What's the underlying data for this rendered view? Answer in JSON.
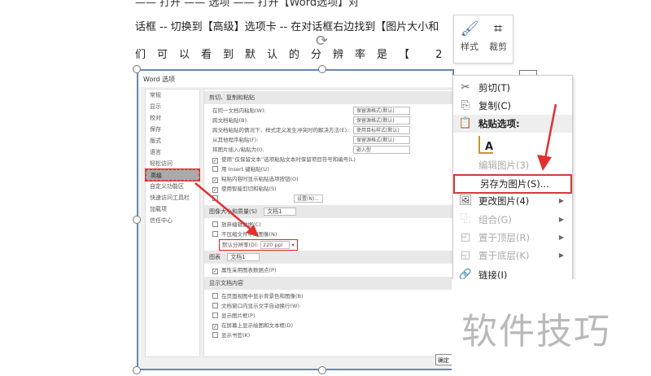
{
  "doc": {
    "line1": "—— 打开 —— 选项 —— 打开【Word选项】对",
    "line2": "话框 -- 切换到【高级】选项卡 -- 在对话框右边找到【图片大小和",
    "line3": "们可以看到默认的分辨率是【 220"
  },
  "mini_toolbar": {
    "style": "样式",
    "crop": "裁剪"
  },
  "dialog": {
    "title": "Word 选项",
    "nav": [
      "常规",
      "显示",
      "校对",
      "保存",
      "版式",
      "语言",
      "轻松访问",
      "高级",
      "自定义功能区",
      "快速访问工具栏",
      "加载项",
      "信任中心"
    ],
    "sec_cut": "剪切、复制和粘贴",
    "paste_rows": [
      {
        "label": "在同一文档内粘贴(W):",
        "value": "保留源格式(默认)"
      },
      {
        "label": "跨文档粘贴(B):",
        "value": "保留源格式(默认)"
      },
      {
        "label": "跨文档粘贴的情况下，样式定义发生冲突时的解决方法(E):",
        "value": "使用目标样式(默认)"
      },
      {
        "label": "从其他程序粘贴(F):",
        "value": "保留源格式(默认)"
      },
      {
        "label": "将图片插入/粘贴为(I):",
        "value": "嵌入型"
      }
    ],
    "paste_checks": [
      {
        "label": "使用“仅保留文本”选项粘贴文本时保留项目符号和编号(L)",
        "checked": true
      },
      {
        "label": "用 Insert 键粘贴(U)",
        "checked": false
      },
      {
        "label": "粘贴内容时显示粘贴选项按钮(O)",
        "checked": true
      },
      {
        "label": "使用智能剪切和粘贴(S)",
        "checked": true
      }
    ],
    "settings_btn": "设置(N)...",
    "sec_image": "图像大小和质量(S)",
    "doc_name": "文档1",
    "image_checks": [
      {
        "label": "放弃编辑数据(C)",
        "checked": false
      },
      {
        "label": "不压缩文件中的图像(N)",
        "checked": false
      }
    ],
    "resolution_label": "默认分辨率(D):",
    "resolution_value": "220 ppi",
    "sec_chart": "图表",
    "chart_check": "属性采用图表数据点(P)",
    "sec_display": "显示文档内容",
    "display_checks": [
      {
        "label": "在页面视图中显示背景色和图像(B)",
        "checked": false
      },
      {
        "label": "文档窗口内显示文字自动换行(W)",
        "checked": false
      },
      {
        "label": "显示图片框(P)",
        "checked": false
      },
      {
        "label": "在屏幕上显示绘图和文本框(D)",
        "checked": true
      },
      {
        "label": "显示书签(K)",
        "checked": false
      }
    ],
    "ok": "确定"
  },
  "context_menu": {
    "cut": "剪切(T)",
    "copy": "复制(C)",
    "paste_options": "粘贴选项:",
    "edit_picture": "编辑图片(3)",
    "save_as_picture": "另存为图片(S)...",
    "change_picture": "更改图片(4)",
    "group": "组合(G)",
    "bring_front": "置于顶层(R)",
    "send_back": "置于底层(K)",
    "link": "链接(I)"
  },
  "watermark": "软件技巧",
  "colors": {
    "highlight": "#d43a3a",
    "selection_border": "#6a86b0"
  }
}
